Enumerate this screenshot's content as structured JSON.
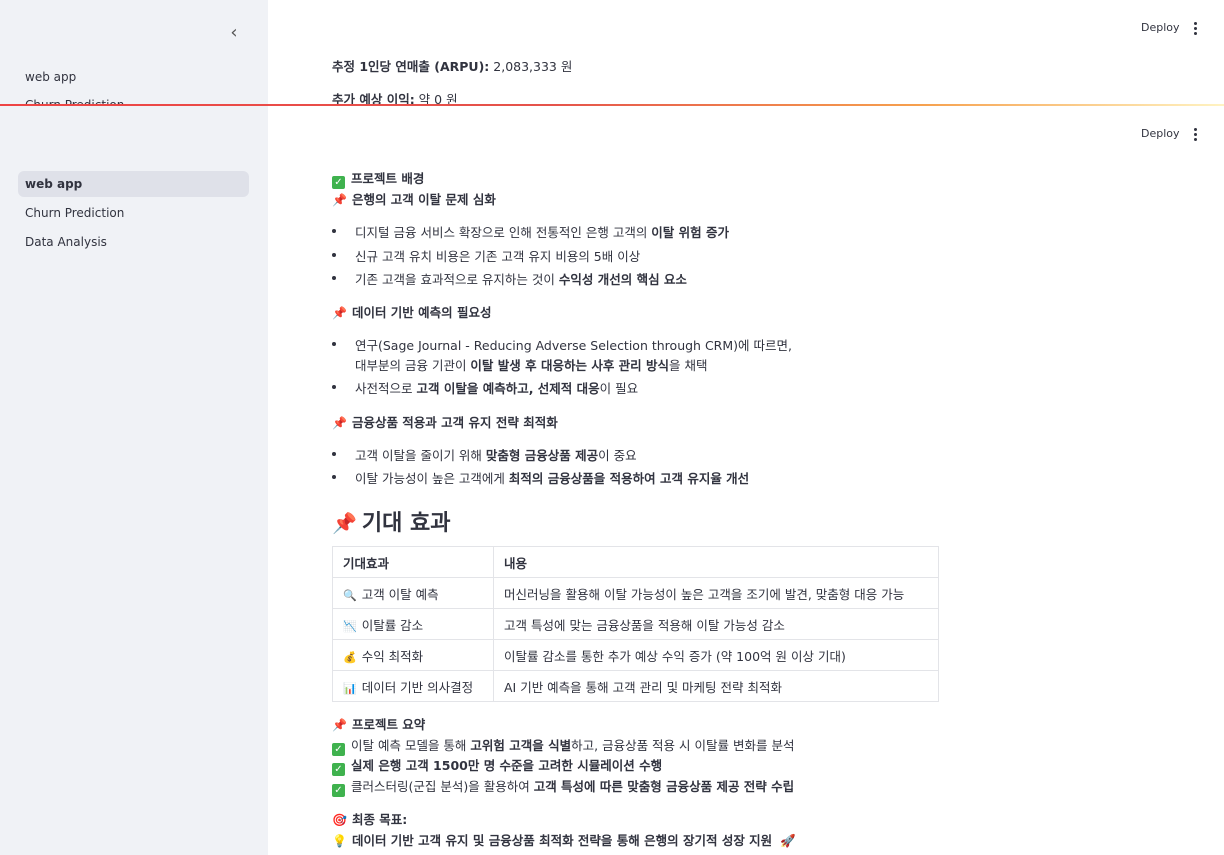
{
  "header": {
    "deploy_label": "Deploy"
  },
  "top_frame": {
    "sidebar_items": [
      "web app",
      "Churn Prediction"
    ],
    "metrics": [
      {
        "label": "추정 1인당 연매출 (ARPU):",
        "value": " 2,083,333 원"
      },
      {
        "label": "추가 예상 이익:",
        "value": " 약 0 원"
      }
    ]
  },
  "sidebar": {
    "items": [
      {
        "label": "web app",
        "active": true
      },
      {
        "label": "Churn Prediction",
        "active": false
      },
      {
        "label": "Data Analysis",
        "active": false
      }
    ]
  },
  "content": {
    "background_title": "프로젝트 배경",
    "section1": {
      "title": "은행의 고객 이탈 문제 심화",
      "b1_pre": "디지털 금융 서비스 확장으로 인해 전통적인 은행 고객의 ",
      "b1_bold": "이탈 위험 증가",
      "b2": "신규 고객 유치 비용은 기존 고객 유지 비용의 5배 이상",
      "b3_pre": "기존 고객을 효과적으로 유지하는 것이 ",
      "b3_bold": "수익성 개선의 핵심 요소"
    },
    "section2": {
      "title": "데이터 기반 예측의 필요성",
      "b1_line1": "연구(Sage Journal - Reducing Adverse Selection through CRM)에 따르면,",
      "b1_line2_pre": "대부분의 금융 기관이 ",
      "b1_line2_bold": "이탈 발생 후 대응하는 사후 관리 방식",
      "b1_line2_post": "을 채택",
      "b2_pre": "사전적으로 ",
      "b2_bold": "고객 이탈을 예측하고, 선제적 대응",
      "b2_post": "이 필요"
    },
    "section3": {
      "title": "금융상품 적용과 고객 유지 전략 최적화",
      "b1_pre": "고객 이탈을 줄이기 위해 ",
      "b1_bold": "맞춤형 금융상품 제공",
      "b1_post": "이 중요",
      "b2_pre": "이탈 가능성이 높은 고객에게 ",
      "b2_bold": "최적의 금융상품을 적용하여 고객 유지율 개선"
    },
    "expected_heading": "기대 효과",
    "table": {
      "headers": [
        "기대효과",
        "내용"
      ],
      "rows": [
        {
          "icon": "magnifier-icon",
          "effect": "고객 이탈 예측",
          "desc": "머신러닝을 활용해 이탈 가능성이 높은 고객을 조기에 발견, 맞춤형 대응 가능"
        },
        {
          "icon": "chart-down-icon",
          "effect": "이탈률 감소",
          "desc": "고객 특성에 맞는 금융상품을 적용해 이탈 가능성 감소"
        },
        {
          "icon": "money-bag-icon",
          "effect": "수익 최적화",
          "desc": "이탈률 감소를 통한 추가 예상 수익 증가 (약 100억 원 이상 기대)"
        },
        {
          "icon": "bar-chart-icon",
          "effect": "데이터 기반 의사결정",
          "desc": "AI 기반 예측을 통해 고객 관리 및 마케팅 전략 최적화"
        }
      ]
    },
    "summary": {
      "title": "프로젝트 요약",
      "c1_pre": "이탈 예측 모델을 통해 ",
      "c1_bold": "고위험 고객을 식별",
      "c1_post": "하고, 금융상품 적용 시 이탈률 변화를 분석",
      "c2_bold": "실제 은행 고객 1500만 명 수준을 고려한 시뮬레이션 수행",
      "c3_pre": "클러스터링(군집 분석)을 활용하여 ",
      "c3_bold": "고객 특성에 따른 맞춤형 금융상품 제공 전략 수립"
    },
    "goal": {
      "title": "최종 목표:",
      "text": "데이터 기반 고객 유지 및 금융상품 최적화 전략을 통해 은행의 장기적 성장 지원"
    }
  },
  "colors": {
    "sidebar_bg": "#f0f2f6",
    "active_item_bg": "#dfe1e9",
    "check_green": "#3fb24e",
    "pin_red": "#d4313b",
    "text": "#31333f"
  }
}
